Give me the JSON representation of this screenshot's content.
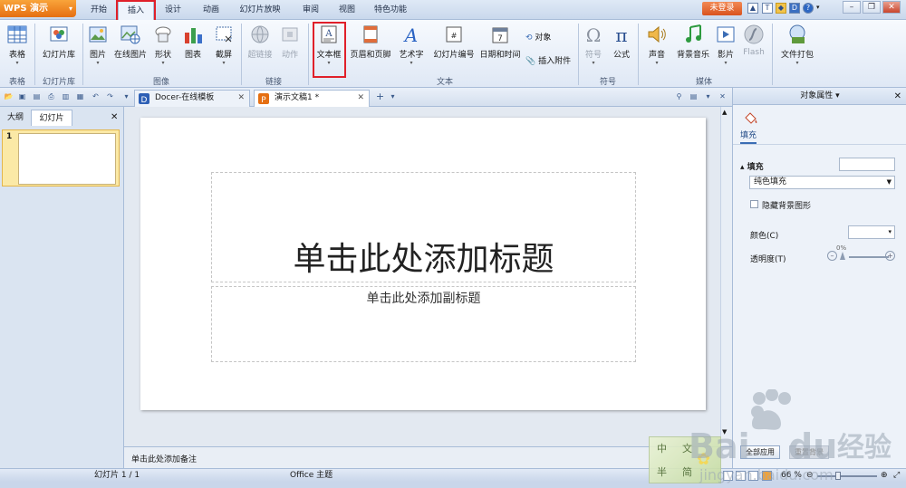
{
  "app": {
    "name": "WPS 演示",
    "login": "未登录"
  },
  "menu": {
    "tabs": [
      "开始",
      "插入",
      "设计",
      "动画",
      "幻灯片放映",
      "审阅",
      "视图",
      "特色功能"
    ],
    "active": "插入"
  },
  "ribbon": {
    "buttons": {
      "table": "表格",
      "slide_library": "幻灯片库",
      "picture": "图片",
      "online_picture": "在线图片",
      "shape": "形状",
      "chart": "图表",
      "screenshot": "截屏",
      "hyperlink": "超链接",
      "action": "动作",
      "textbox": "文本框",
      "header_footer": "页眉和页脚",
      "wordart": "艺术字",
      "slide_number": "幻灯片编号",
      "datetime": "日期和时间",
      "object": "对象",
      "attachment": "插入附件",
      "symbol": "符号",
      "formula": "公式",
      "sound": "声音",
      "bg_music": "背景音乐",
      "movie": "影片",
      "flash": "Flash",
      "package": "文件打包"
    },
    "groups": {
      "table": "表格",
      "slide_library": "幻灯片库",
      "image": "图像",
      "link": "链接",
      "text": "文本",
      "symbol": "符号",
      "media": "媒体"
    }
  },
  "doc_tabs": [
    {
      "label": "Docer-在线模板",
      "active": false
    },
    {
      "label": "演示文稿1 *",
      "active": true
    }
  ],
  "left_panel": {
    "tabs": [
      "大纲",
      "幻灯片"
    ],
    "active": "幻灯片",
    "slide_number": "1"
  },
  "slide": {
    "title": "单击此处添加标题",
    "subtitle": "单击此处添加副标题"
  },
  "notes": {
    "placeholder": "单击此处添加备注"
  },
  "right_panel": {
    "title": "对象属性",
    "tab": "填充",
    "section": "填充",
    "fill_type": "纯色填充",
    "hide_bg_label": "隐藏背景图形",
    "color_label": "颜色(C)",
    "transparency_label": "透明度(T)",
    "transparency_value": "0%",
    "apply_all": "全部应用",
    "reset_bg": "重置背景"
  },
  "status": {
    "slide_counter": "幻灯片 1 / 1",
    "theme": "Office 主题",
    "zoom": "66 %"
  },
  "watermark": {
    "site": "jingyan.baidu.com",
    "badge_chars": [
      "中",
      "文",
      "半",
      "简"
    ]
  },
  "colors": {
    "accent_red": "#e0202a",
    "wps_orange": "#e56f12",
    "ribbon_blue": "#dfe8f5"
  }
}
